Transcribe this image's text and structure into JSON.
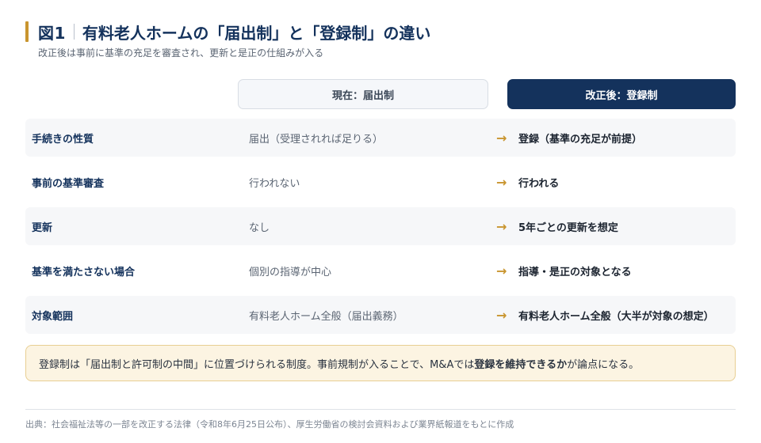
{
  "header": {
    "figure_number": "図1",
    "title": "有料老人ホームの「届出制」と「登録制」の違い",
    "subtitle": "改正後は事前に基準の充足を審査され、更新と是正の仕組みが入る"
  },
  "columns": {
    "current": "現在：届出制",
    "after": "改正後：登録制"
  },
  "rows": [
    {
      "label": "手続きの性質",
      "current": "届出（受理されれば足りる）",
      "after": "登録（基準の充足が前提）"
    },
    {
      "label": "事前の基準審査",
      "current": "行われない",
      "after": "行われる"
    },
    {
      "label": "更新",
      "current": "なし",
      "after": "5年ごとの更新を想定"
    },
    {
      "label": "基準を満たさない場合",
      "current": "個別の指導が中心",
      "after": "指導・是正の対象となる"
    },
    {
      "label": "対象範囲",
      "current": "有料老人ホーム全般（届出義務）",
      "after": "有料老人ホーム全般（大半が対象の想定）"
    }
  ],
  "arrow_glyph": "→",
  "note": {
    "part1": "登録制は「届出制と許可制の中間」に位置づけられる制度。事前規制が入ることで、M&Aでは",
    "strong": "登録を維持できるか",
    "part2": "が論点になる。"
  },
  "source": "出典：社会福祉法等の一部を改正する法律（令和8年6月25日公布）、厚生労働省の検討会資料および業界紙報道をもとに作成",
  "colors": {
    "accent": "#c9952f",
    "navy": "#14325c",
    "note_bg": "#fcf4e2"
  }
}
